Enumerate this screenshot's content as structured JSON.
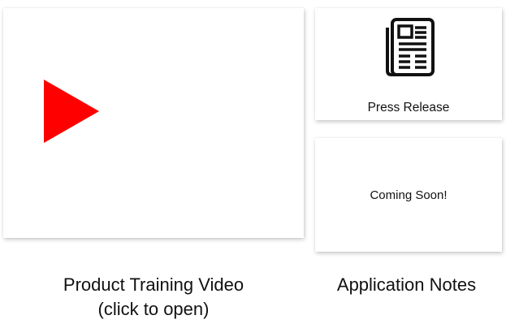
{
  "video_tile": {
    "icon": "play-icon",
    "play_color": "#ff0000",
    "caption_line1": "Product Training Video",
    "caption_line2": "(click to open)"
  },
  "press_tile": {
    "icon": "newspaper-icon",
    "label": "Press Release"
  },
  "app_notes_tile": {
    "status": "Coming Soon!",
    "caption": "Application Notes"
  }
}
